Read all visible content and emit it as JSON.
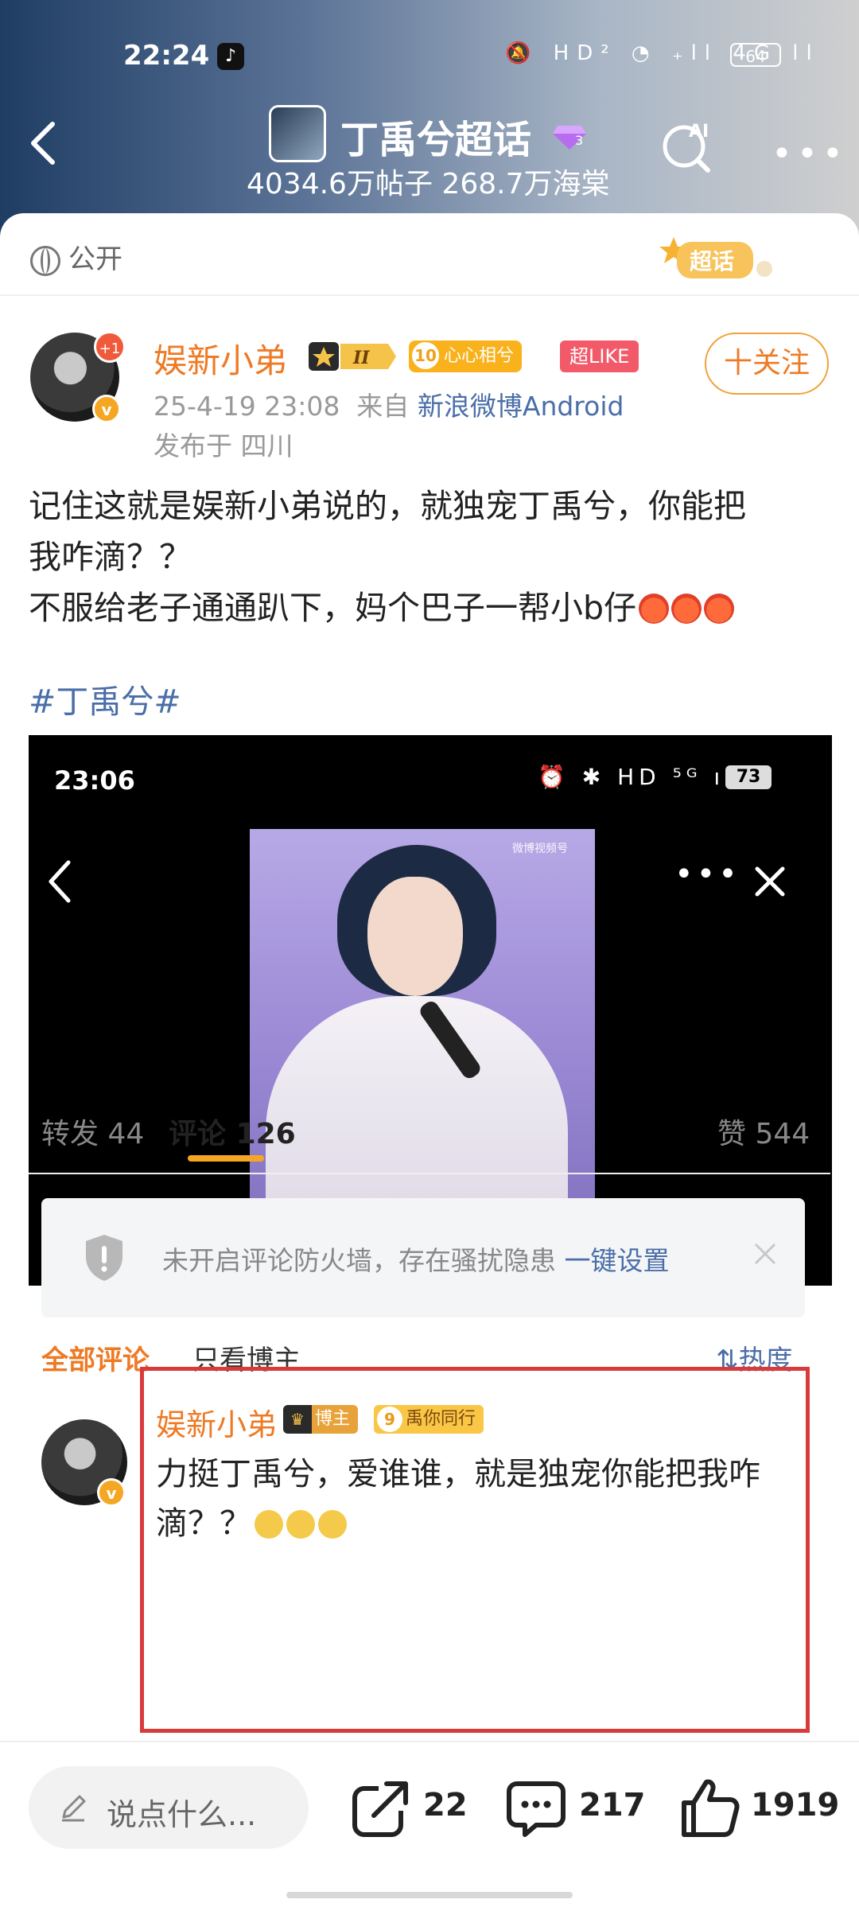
{
  "status_bar": {
    "time": "22:24",
    "icons_text": "🔕 HD² ◔ ₊ll 4G ll",
    "battery": "64"
  },
  "header": {
    "topic_title": "丁禹兮超话",
    "topic_stats": "4034.6万帖子 268.7万海棠",
    "gem_level": "3"
  },
  "post": {
    "visibility": "公开",
    "chaohua_badge": "超话",
    "author": {
      "name": "娱新小弟",
      "plus_badge": "+1",
      "level_badge": "II",
      "fan_badge_num": "10",
      "fan_badge_text": "心心相兮",
      "like_badge": "超LIKE",
      "follow_label": "十关注",
      "time": "25-4-19 23:08",
      "source_prefix": "来自",
      "source": "新浪微博Android",
      "location": "发布于 四川"
    },
    "content_lines": [
      "记住这就是娱新小弟说的，就独宠丁禹兮，你能把",
      "我咋滴？？",
      "不服给老子通通趴下，妈个巴子一帮小b仔"
    ],
    "hashtag": "#丁禹兮#",
    "video": {
      "time": "23:06",
      "icons_text": "⏰ ✱ HD ⁵ᴳ ıll",
      "battery": "73",
      "watermark": "微博视频号"
    }
  },
  "tabs": {
    "repost_label": "转发",
    "repost_count": "44",
    "comment_label": "评论",
    "comment_count": "126",
    "like_label": "赞",
    "like_count": "544"
  },
  "notice": {
    "text": "未开启评论防火墙，存在骚扰隐患",
    "link": "一键设置"
  },
  "filters": {
    "all": "全部评论",
    "owner_only": "只看博主",
    "sort": "热度"
  },
  "comment": {
    "name": "娱新小弟",
    "owner_badge": "博主",
    "fan_badge_num": "9",
    "fan_badge_text": "禹你同行",
    "text": "力挺丁禹兮，爱谁谁，就是独宠你能把我咋滴？？"
  },
  "bottom": {
    "input_placeholder": "说点什么...",
    "share_count": "22",
    "comment_count": "217",
    "like_count": "1919"
  },
  "colors": {
    "accent_orange": "#ee7a24",
    "link_blue": "#4a6ea8",
    "highlight_red": "#d93b3b"
  }
}
